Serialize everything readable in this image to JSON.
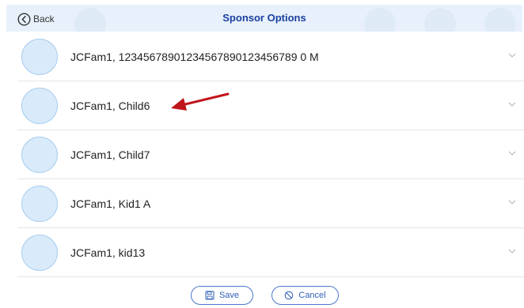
{
  "header": {
    "back_label": "Back",
    "title": "Sponsor Options"
  },
  "sponsors": [
    {
      "name": "JCFam1, 12345678901234567890123456789 0 M"
    },
    {
      "name": "JCFam1, Child6"
    },
    {
      "name": "JCFam1, Child7"
    },
    {
      "name": "JCFam1, Kid1 A"
    },
    {
      "name": "JCFam1, kid13"
    }
  ],
  "footer": {
    "save_label": "Save",
    "cancel_label": "Cancel"
  },
  "colors": {
    "header_bg": "#e8f1fb",
    "title": "#1a3fa0",
    "avatar_fill": "#d9ebfa",
    "avatar_border": "#a8cdef",
    "button_accent": "#2f5fb5",
    "annotation_arrow": "#c0151b"
  },
  "icons": {
    "back": "circle-chevron-left-icon",
    "row_expand": "chevron-down-icon",
    "save": "floppy-disk-icon",
    "cancel": "prohibited-icon"
  }
}
